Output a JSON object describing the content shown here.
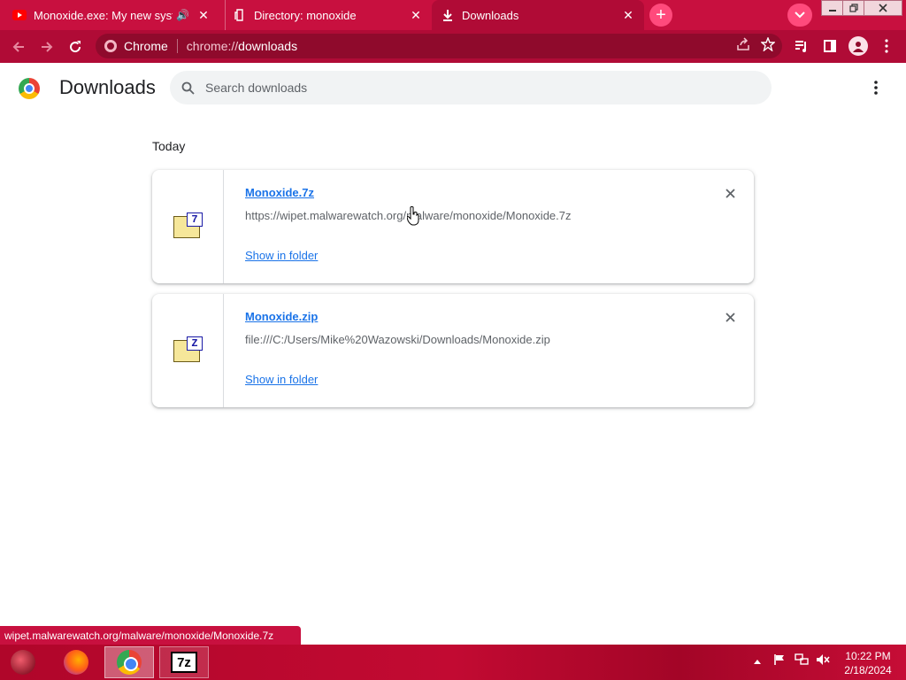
{
  "tabs": [
    {
      "title": "Monoxide.exe: My new syste",
      "favicon": "youtube-icon",
      "audio": "speaker-icon"
    },
    {
      "title": "Directory: monoxide",
      "favicon": "folder-page-icon"
    },
    {
      "title": "Downloads",
      "favicon": "download-icon",
      "active": true
    }
  ],
  "toolbar": {
    "omnibox_site": "Chrome",
    "url_scheme": "chrome://",
    "url_path": "downloads"
  },
  "page": {
    "title": "Downloads",
    "search_placeholder": "Search downloads",
    "section_date": "Today"
  },
  "downloads": [
    {
      "file_name": "Monoxide.7z",
      "url": "https://wipet.malwarewatch.org/malware/monoxide/Monoxide.7z",
      "action": "Show in folder",
      "icon_badge": "7"
    },
    {
      "file_name": "Monoxide.zip",
      "url": "file:///C:/Users/Mike%20Wazowski/Downloads/Monoxide.zip",
      "action": "Show in folder",
      "icon_badge": "Z"
    }
  ],
  "status_bar": "wipet.malwarewatch.org/malware/monoxide/Monoxide.7z",
  "taskbar": {
    "zip_label": "7z",
    "time": "10:22 PM",
    "date": "2/18/2024"
  },
  "colors": {
    "theme": "#c8103f",
    "link": "#1a73e8"
  }
}
